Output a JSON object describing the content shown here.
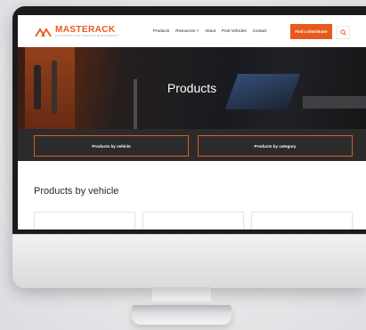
{
  "site": {
    "logo_name": "MASTERACK",
    "logo_tagline": "SOLUTIONS FOR VEHICLE MANAGEMENT"
  },
  "nav": {
    "items": [
      {
        "label": "Products"
      },
      {
        "label": "Resources ˅"
      },
      {
        "label": "About"
      },
      {
        "label": "Pool Vehicles"
      },
      {
        "label": "Contact"
      }
    ],
    "cta_label": "Find a Distributor",
    "search_icon": "search-icon"
  },
  "hero": {
    "title": "Products"
  },
  "category_buttons": [
    {
      "label": "Products by vehicle"
    },
    {
      "label": "Products by category"
    }
  ],
  "section": {
    "title": "Products by vehicle"
  },
  "colors": {
    "accent": "#e8591c",
    "band": "#2b2b2c"
  }
}
